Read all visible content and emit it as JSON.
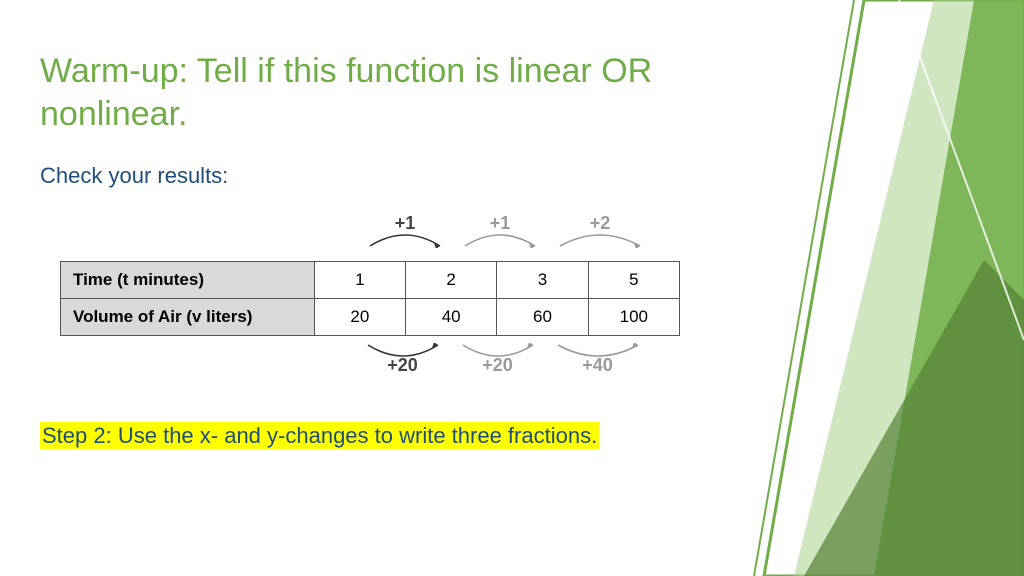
{
  "title": "Warm-up:  Tell if this function is linear OR nonlinear.",
  "subtitle": "Check your results:",
  "table": {
    "row1_label": "Time (t minutes)",
    "row2_label": "Volume of Air (v liters)",
    "r1c1": "1",
    "r1c2": "2",
    "r1c3": "3",
    "r1c4": "5",
    "r2c1": "20",
    "r2c2": "40",
    "r2c3": "60",
    "r2c4": "100"
  },
  "deltas": {
    "top1": "+1",
    "top2": "+1",
    "top3": "+2",
    "bot1": "+20",
    "bot2": "+20",
    "bot3": "+40"
  },
  "step2_prefix": "Step 2:   ",
  "step2_text": "Use the x- and y-changes to write three fractions.",
  "chart_data": {
    "type": "table",
    "title": "Warm-up: Tell if this function is linear OR nonlinear.",
    "columns": [
      "Time (t minutes)",
      "Volume of Air (v liters)"
    ],
    "rows": [
      {
        "t": 1,
        "v": 20
      },
      {
        "t": 2,
        "v": 40
      },
      {
        "t": 3,
        "v": 60
      },
      {
        "t": 5,
        "v": 100
      }
    ],
    "x_deltas": [
      1,
      1,
      2
    ],
    "y_deltas": [
      20,
      20,
      40
    ]
  }
}
